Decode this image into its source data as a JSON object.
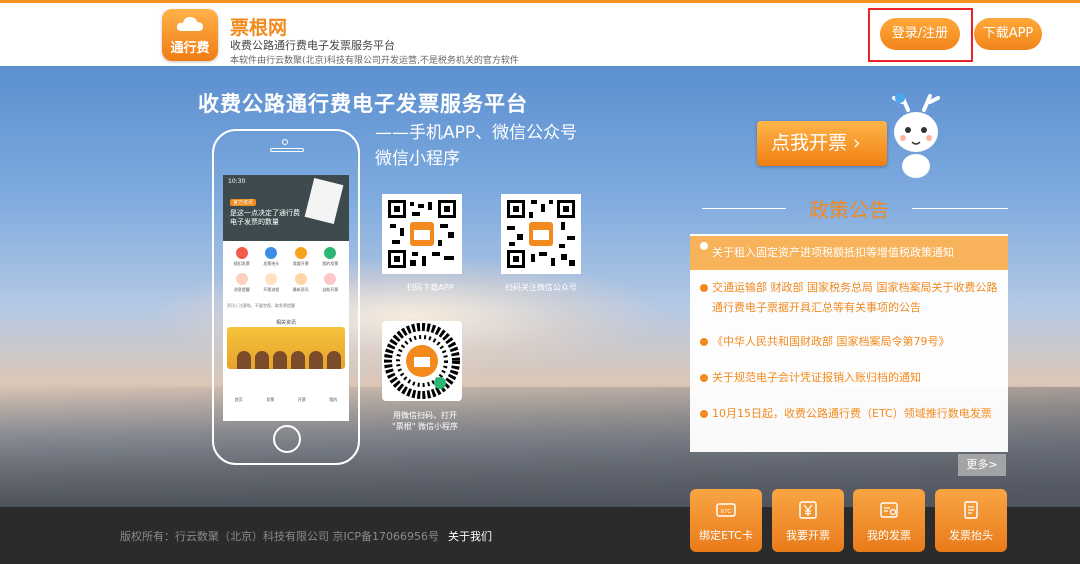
{
  "header": {
    "logo_text": "通行费",
    "brand_name": "票根网",
    "brand_subtitle": "收费公路通行费电子发票服务平台",
    "brand_note": "本软件由行云数聚(北京)科技有限公司开发运营,不是税务机关的官方软件",
    "login_label": "登录/注册",
    "download_label": "下载APP"
  },
  "hero": {
    "title": "收费公路通行费电子发票服务平台",
    "subtitle_line1": "——手机APP、微信公众号",
    "subtitle_line2": "微信小程序",
    "qr_app_caption": "扫码下载APP",
    "qr_wechat_caption": "扫码关注微信公众号",
    "qr_mini_caption_line1": "用微信扫码，打开",
    "qr_mini_caption_line2": "\"票根\" 微信小程序"
  },
  "phone_screen": {
    "time": "10:30",
    "tag": "官方资讯",
    "headline": "是这一点决定了通行费电子发票的数量",
    "icons": [
      "随扣发票",
      "发票抬头",
      "我要开票",
      "我的发票",
      "消息提醒",
      "开票流程",
      "最新资讯",
      "自助开票"
    ],
    "ticker": "资讯 | 注意啦，不要忽视，取发票提醒",
    "section": "相关资讯",
    "tabs": [
      "首页",
      "发票",
      "开票",
      "我的"
    ]
  },
  "cta": {
    "label": "点我开票 ›"
  },
  "policy": {
    "title": "政策公告",
    "items": [
      {
        "text": "关于租入固定资产进项税额抵扣等增值税政策通知",
        "active": true
      },
      {
        "text": "交通运输部 财政部 国家税务总局 国家档案局关于收费公路通行费电子票据开具汇总等有关事项的公告",
        "active": false
      },
      {
        "text": "《中华人民共和国财政部 国家档案局令第79号》",
        "active": false
      },
      {
        "text": "关于规范电子会计凭证报销入账归档的通知",
        "active": false
      },
      {
        "text": "10月15日起，收费公路通行费（ETC）领域推行数电发票",
        "active": false
      }
    ],
    "more_label": "更多>"
  },
  "quick_actions": [
    {
      "label": "绑定ETC卡",
      "icon": "etc-card-icon"
    },
    {
      "label": "我要开票",
      "icon": "yen-icon"
    },
    {
      "label": "我的发票",
      "icon": "invoice-icon"
    },
    {
      "label": "发票抬头",
      "icon": "document-icon"
    }
  ],
  "footer": {
    "copyright": "版权所有：行云数聚（北京）科技有限公司 京ICP备17066956号",
    "about_label": "关于我们"
  },
  "colors": {
    "accent": "#f28a1e",
    "highlight": "#e8232a",
    "footer_bg": "#2b2b2b"
  }
}
